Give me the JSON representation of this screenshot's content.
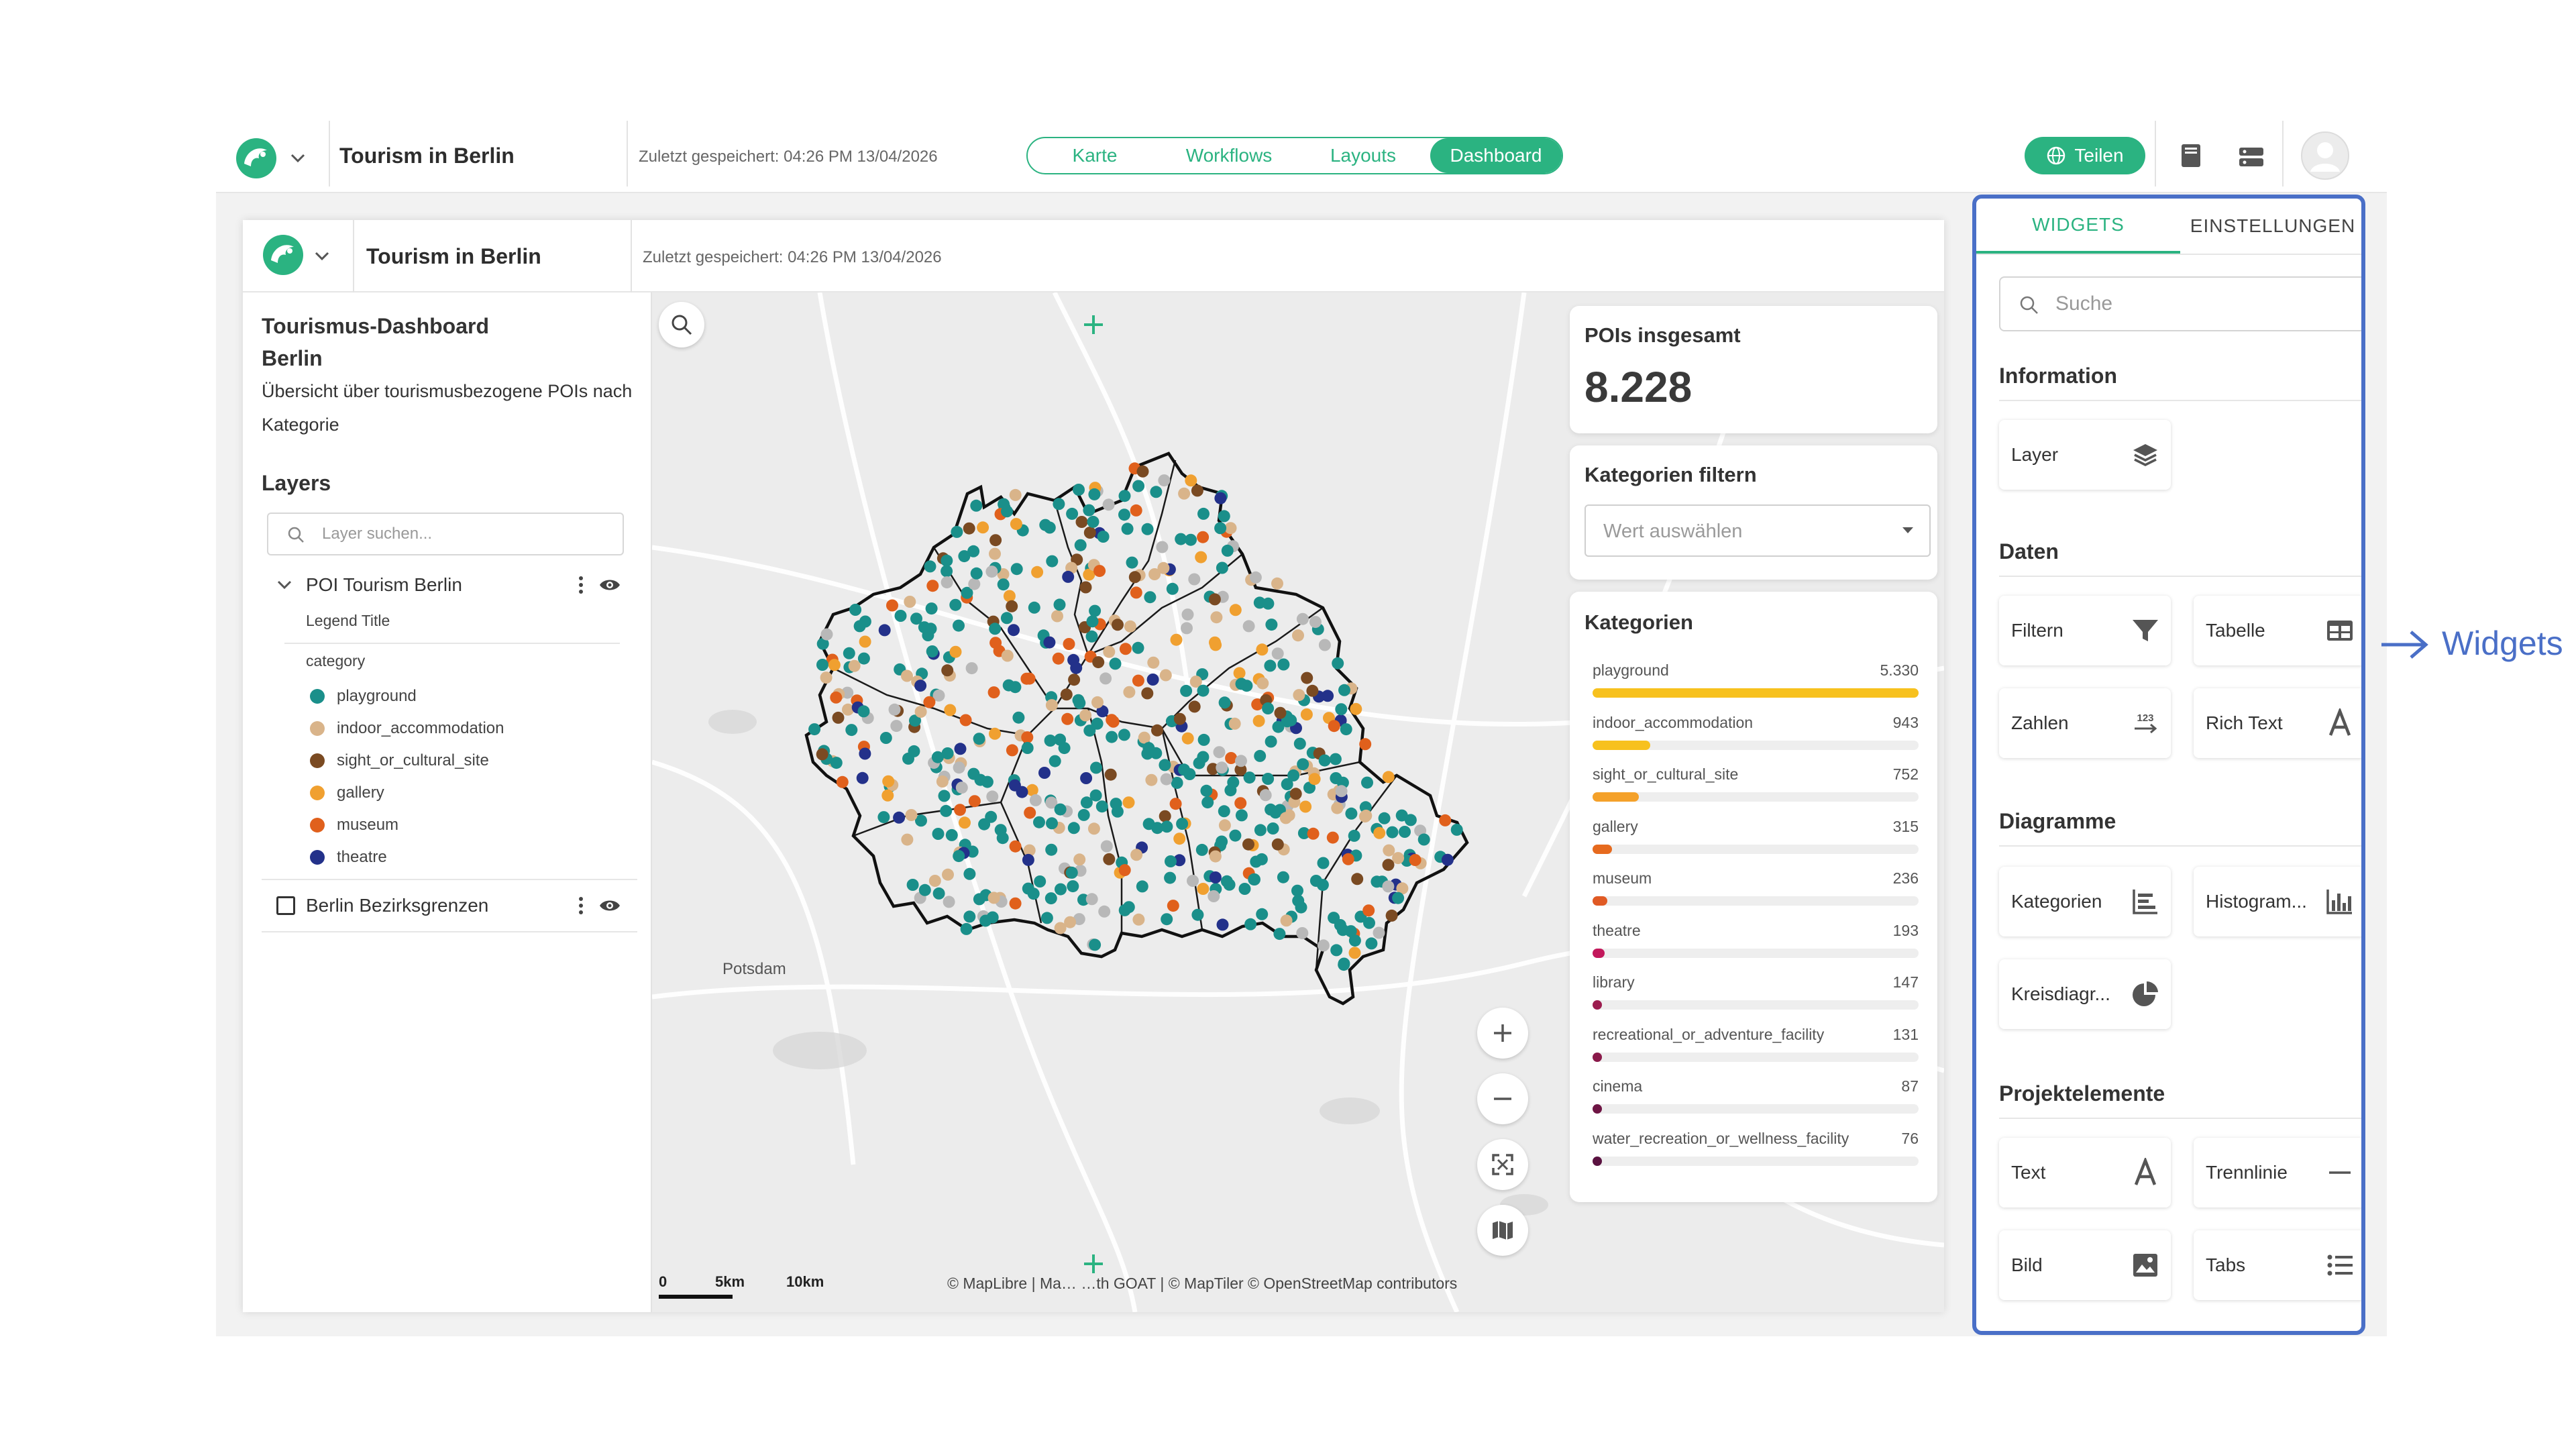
{
  "app": {
    "project_title": "Tourism in Berlin",
    "saved_text": "Zuletzt gespeichert: 04:26 PM 13/04/2026",
    "tabs": [
      {
        "label": "Karte",
        "active": false
      },
      {
        "label": "Workflows",
        "active": false
      },
      {
        "label": "Layouts",
        "active": false
      },
      {
        "label": "Dashboard",
        "active": true
      }
    ],
    "share_label": "Teilen",
    "accent_color": "#2bb381"
  },
  "dashboard": {
    "project_title": "Tourism in Berlin",
    "saved_text": "Zuletzt gespeichert: 04:26 PM 13/04/2026",
    "info_title": "Tourismus-Dashboard Berlin",
    "info_text": "Übersicht über tourismusbezogene POIs nach Kategorie",
    "layers_heading": "Layers",
    "layer_search_placeholder": "Layer suchen...",
    "layers": [
      {
        "name": "POI Tourism Berlin",
        "legend_title": "Legend Title",
        "legend_field": "category",
        "legend": [
          {
            "label": "playground",
            "color": "#1a8f8a"
          },
          {
            "label": "indoor_accommodation",
            "color": "#d9b48a"
          },
          {
            "label": "sight_or_cultural_site",
            "color": "#7a4a22"
          },
          {
            "label": "gallery",
            "color": "#f0a030"
          },
          {
            "label": "museum",
            "color": "#e0601c"
          },
          {
            "label": "theatre",
            "color": "#23318a"
          }
        ]
      },
      {
        "name": "Berlin Bezirksgrenzen"
      }
    ]
  },
  "map": {
    "place_label": "Potsdam",
    "scale_labels": [
      "0",
      "5km",
      "10km"
    ],
    "attribution": "© MapLibre | Ma… …th GOAT | © MapTiler © OpenStreetMap contributors"
  },
  "widgets_on_map": {
    "total": {
      "title": "POIs insgesamt",
      "value": "8.228"
    },
    "filter": {
      "title": "Kategorien filtern",
      "placeholder": "Wert auswählen"
    },
    "categories": {
      "title": "Kategorien",
      "items": [
        {
          "label": "playground",
          "value_text": "5.330",
          "value": 5330,
          "color": "#f7c11e"
        },
        {
          "label": "indoor_accommodation",
          "value_text": "943",
          "value": 943,
          "color": "#f7c11e"
        },
        {
          "label": "sight_or_cultural_site",
          "value_text": "752",
          "value": 752,
          "color": "#f4a12a"
        },
        {
          "label": "gallery",
          "value_text": "315",
          "value": 315,
          "color": "#e66a1e"
        },
        {
          "label": "museum",
          "value_text": "236",
          "value": 236,
          "color": "#e05a24"
        },
        {
          "label": "theatre",
          "value_text": "193",
          "value": 193,
          "color": "#c2185b"
        },
        {
          "label": "library",
          "value_text": "147",
          "value": 147,
          "color": "#9c1d4f"
        },
        {
          "label": "recreational_or_adventure_facility",
          "value_text": "131",
          "value": 131,
          "color": "#8a1a4a"
        },
        {
          "label": "cinema",
          "value_text": "87",
          "value": 87,
          "color": "#6e1544"
        },
        {
          "label": "water_recreation_or_wellness_facility",
          "value_text": "76",
          "value": 76,
          "color": "#5a1240"
        }
      ]
    }
  },
  "sidebar": {
    "tabs": [
      {
        "label": "WIDGETS",
        "active": true
      },
      {
        "label": "EINSTELLUNGEN",
        "active": false
      }
    ],
    "search_placeholder": "Suche",
    "sections": [
      {
        "heading": "Information",
        "items": [
          {
            "label": "Layer",
            "icon": "layers-icon"
          }
        ]
      },
      {
        "heading": "Daten",
        "items": [
          {
            "label": "Filtern",
            "icon": "filter-icon"
          },
          {
            "label": "Tabelle",
            "icon": "table-icon"
          },
          {
            "label": "Zahlen",
            "icon": "numbers-icon"
          },
          {
            "label": "Rich Text",
            "icon": "text-icon"
          }
        ]
      },
      {
        "heading": "Diagramme",
        "items": [
          {
            "label": "Kategorien",
            "icon": "bar-chart-icon"
          },
          {
            "label": "Histogram...",
            "icon": "histogram-icon"
          },
          {
            "label": "Kreisdiagr...",
            "icon": "pie-chart-icon"
          }
        ]
      },
      {
        "heading": "Projektelemente",
        "items": [
          {
            "label": "Text",
            "icon": "text-icon"
          },
          {
            "label": "Trennlinie",
            "icon": "divider-icon"
          },
          {
            "label": "Bild",
            "icon": "image-icon"
          },
          {
            "label": "Tabs",
            "icon": "list-icon"
          }
        ]
      }
    ]
  },
  "annotation": {
    "label": "Widgets",
    "color": "#4a6fc7"
  }
}
